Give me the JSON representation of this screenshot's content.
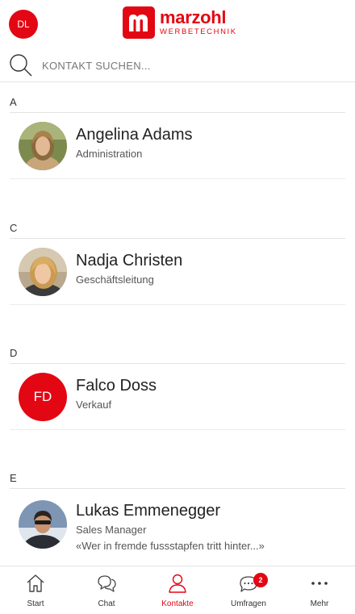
{
  "header": {
    "user_initials": "DL",
    "logo_word": "marzohl",
    "logo_sub": "WERBETECHNIK"
  },
  "search": {
    "placeholder": "KONTAKT SUCHEN..."
  },
  "sections": [
    {
      "letter": "A",
      "contacts": [
        {
          "name": "Angelina Adams",
          "role": "Administration"
        }
      ]
    },
    {
      "letter": "C",
      "contacts": [
        {
          "name": "Nadja Christen",
          "role": "Geschäftsleitung"
        }
      ]
    },
    {
      "letter": "D",
      "contacts": [
        {
          "name": "Falco Doss",
          "role": "Verkauf",
          "initials": "FD"
        }
      ]
    },
    {
      "letter": "E",
      "contacts": [
        {
          "name": "Lukas Emmenegger",
          "role": "Sales Manager",
          "quote": "«Wer in fremde fussstapfen tritt hinter...»"
        }
      ]
    }
  ],
  "tabbar": {
    "tabs": [
      {
        "label": "Start",
        "icon": "home-icon"
      },
      {
        "label": "Chat",
        "icon": "chat-icon"
      },
      {
        "label": "Kontakte",
        "icon": "contacts-icon",
        "active": true
      },
      {
        "label": "Umfragen",
        "icon": "survey-icon",
        "badge": "2"
      },
      {
        "label": "Mehr",
        "icon": "more-icon"
      }
    ]
  },
  "colors": {
    "accent": "#e30613",
    "divider": "#e4e4e4"
  }
}
